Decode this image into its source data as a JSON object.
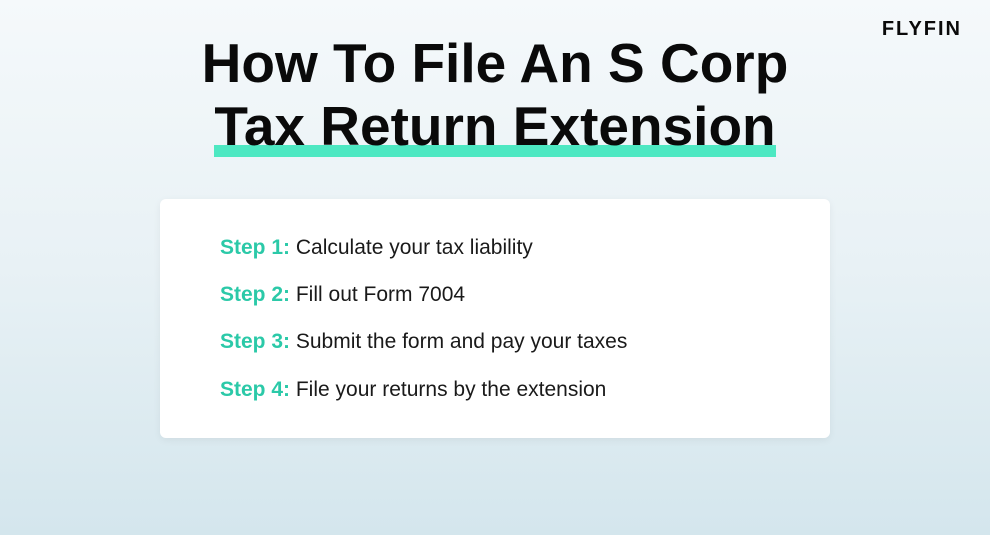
{
  "brand": "FLYFIN",
  "title": {
    "line1": "How To File An S Corp",
    "line2": "Tax Return Extension"
  },
  "steps": [
    {
      "label": "Step 1:",
      "text": "Calculate your tax liability"
    },
    {
      "label": "Step 2:",
      "text": "Fill out Form 7004"
    },
    {
      "label": "Step 3:",
      "text": "Submit the form and pay your taxes"
    },
    {
      "label": "Step 4:",
      "text": "File your returns by the extension"
    }
  ]
}
